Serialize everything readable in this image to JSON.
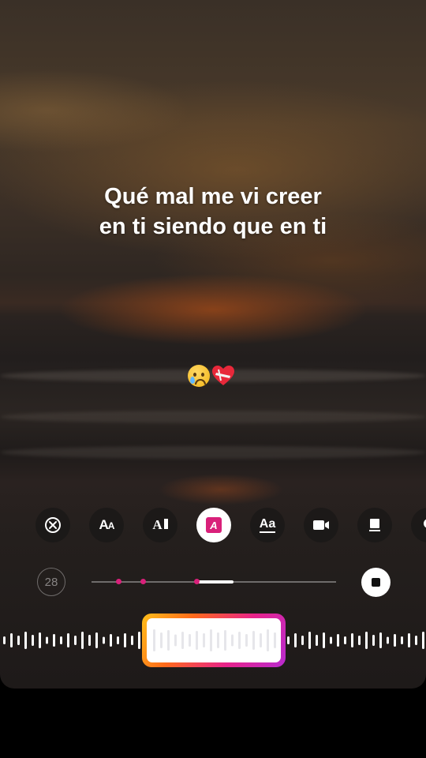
{
  "lyrics": {
    "line1": "Qué mal me vi creer",
    "line2": "en ti siendo que en ti"
  },
  "stickers": [
    "crying-face-emoji",
    "mending-heart-emoji"
  ],
  "toolbar": {
    "items": [
      {
        "name": "remove-lyrics",
        "icon": "close-circle-icon"
      },
      {
        "name": "font-size-style",
        "label": "Aa"
      },
      {
        "name": "text-align-style",
        "label": "A"
      },
      {
        "name": "highlight-style",
        "label": "A",
        "active": true
      },
      {
        "name": "underline-style",
        "label": "Aa"
      },
      {
        "name": "video-style",
        "icon": "camera-icon"
      },
      {
        "name": "card-style",
        "icon": "card-icon"
      },
      {
        "name": "more-style",
        "icon": "partial-icon"
      }
    ]
  },
  "slider": {
    "size_value": "28",
    "playback_position": 0.43,
    "selection_start": 0.43,
    "selection_end": 0.58,
    "markers": [
      0.11,
      0.21,
      0.43
    ]
  },
  "colors": {
    "accent_pink": "#d9207a",
    "gradient": [
      "#ffc01a",
      "#ff6a1a",
      "#e8238a",
      "#b82bd0"
    ]
  }
}
